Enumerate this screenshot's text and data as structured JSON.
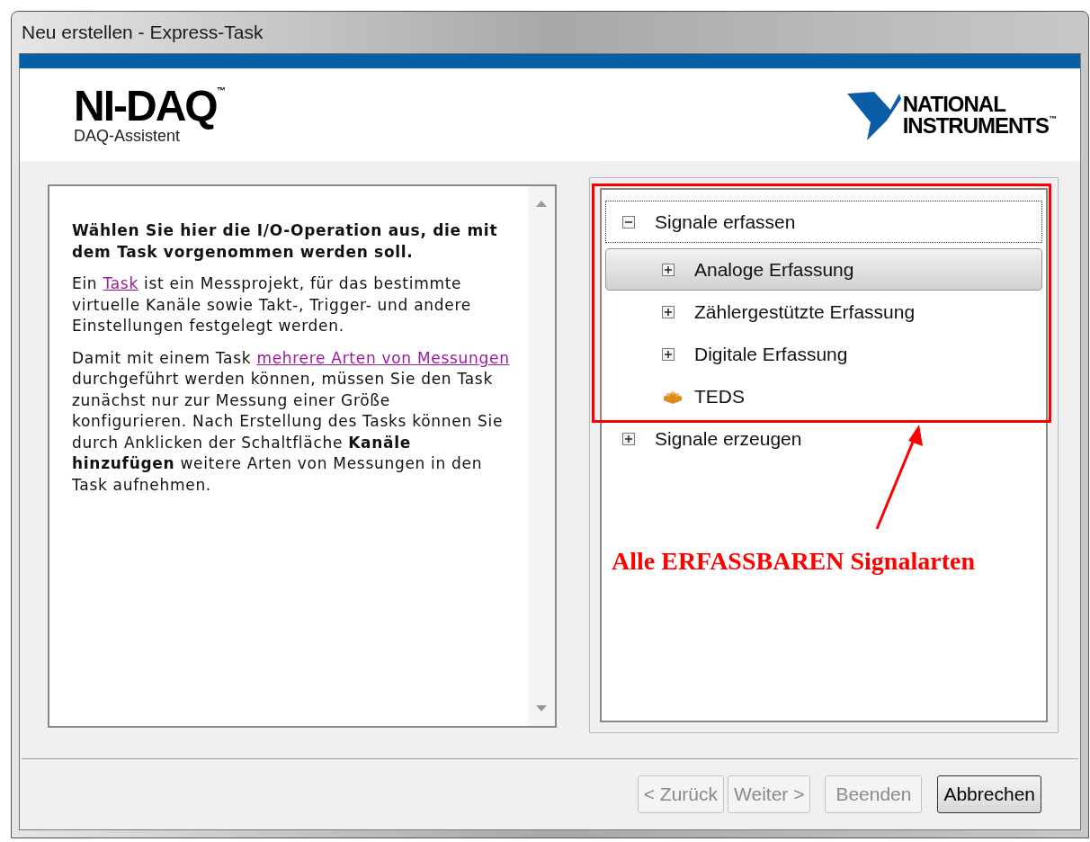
{
  "window": {
    "title": "Neu erstellen - Express-Task"
  },
  "header": {
    "product": "NI-DAQ",
    "product_mark": "™",
    "subtitle": "DAQ-Assistent",
    "logo_lines": [
      "NATIONAL",
      "INSTRUMENTS"
    ],
    "logo_mark": "™"
  },
  "help": {
    "heading": "Wählen Sie hier die I/O-Operation aus, die mit dem Task vorgenommen werden soll.",
    "paragraphs": [
      [
        {
          "kind": "text",
          "text": "Ein "
        },
        {
          "kind": "link",
          "text": "Task"
        },
        {
          "kind": "text",
          "text": " ist ein Messprojekt, für das bestimmte virtuelle Kanäle sowie Takt-, Trigger- und andere Einstellungen festgelegt werden."
        }
      ],
      [
        {
          "kind": "text",
          "text": "Damit mit einem Task "
        },
        {
          "kind": "link",
          "text": "mehrere Arten von Messungen"
        },
        {
          "kind": "text",
          "text": " durchgeführt werden können, müssen Sie den Task zunächst nur zur Messung einer Größe konfigurieren. Nach Erstellung des Tasks können Sie durch Anklicken der Schaltfläche **Kanäle hinzufügen** weitere Arten von Messungen in den Task aufnehmen."
        }
      ]
    ]
  },
  "tree": [
    {
      "label": "Signale erfassen",
      "kind": "folder",
      "expanded": true,
      "selected": false,
      "focused": true,
      "children": [
        {
          "label": "Analoge Erfassung",
          "kind": "folder",
          "expanded": false,
          "selected": true,
          "focused": false
        },
        {
          "label": "Zählergestützte Erfassung",
          "kind": "folder",
          "expanded": false,
          "selected": false,
          "focused": false
        },
        {
          "label": "Digitale Erfassung",
          "kind": "folder",
          "expanded": false,
          "selected": false,
          "focused": false
        },
        {
          "label": "TEDS",
          "kind": "teds",
          "selected": false,
          "focused": false
        }
      ]
    },
    {
      "label": "Signale erzeugen",
      "kind": "folder",
      "expanded": false,
      "selected": false,
      "focused": false
    }
  ],
  "annotation": {
    "text": "Alle ERFASSBAREN Signalarten"
  },
  "buttons": [
    {
      "label": "< Zurück",
      "disabled": true,
      "default": false
    },
    {
      "label": "Weiter >",
      "disabled": true,
      "default": false
    },
    {
      "label": "Beenden",
      "disabled": true,
      "default": false
    },
    {
      "label": "Abbrechen",
      "disabled": false,
      "default": true
    }
  ]
}
